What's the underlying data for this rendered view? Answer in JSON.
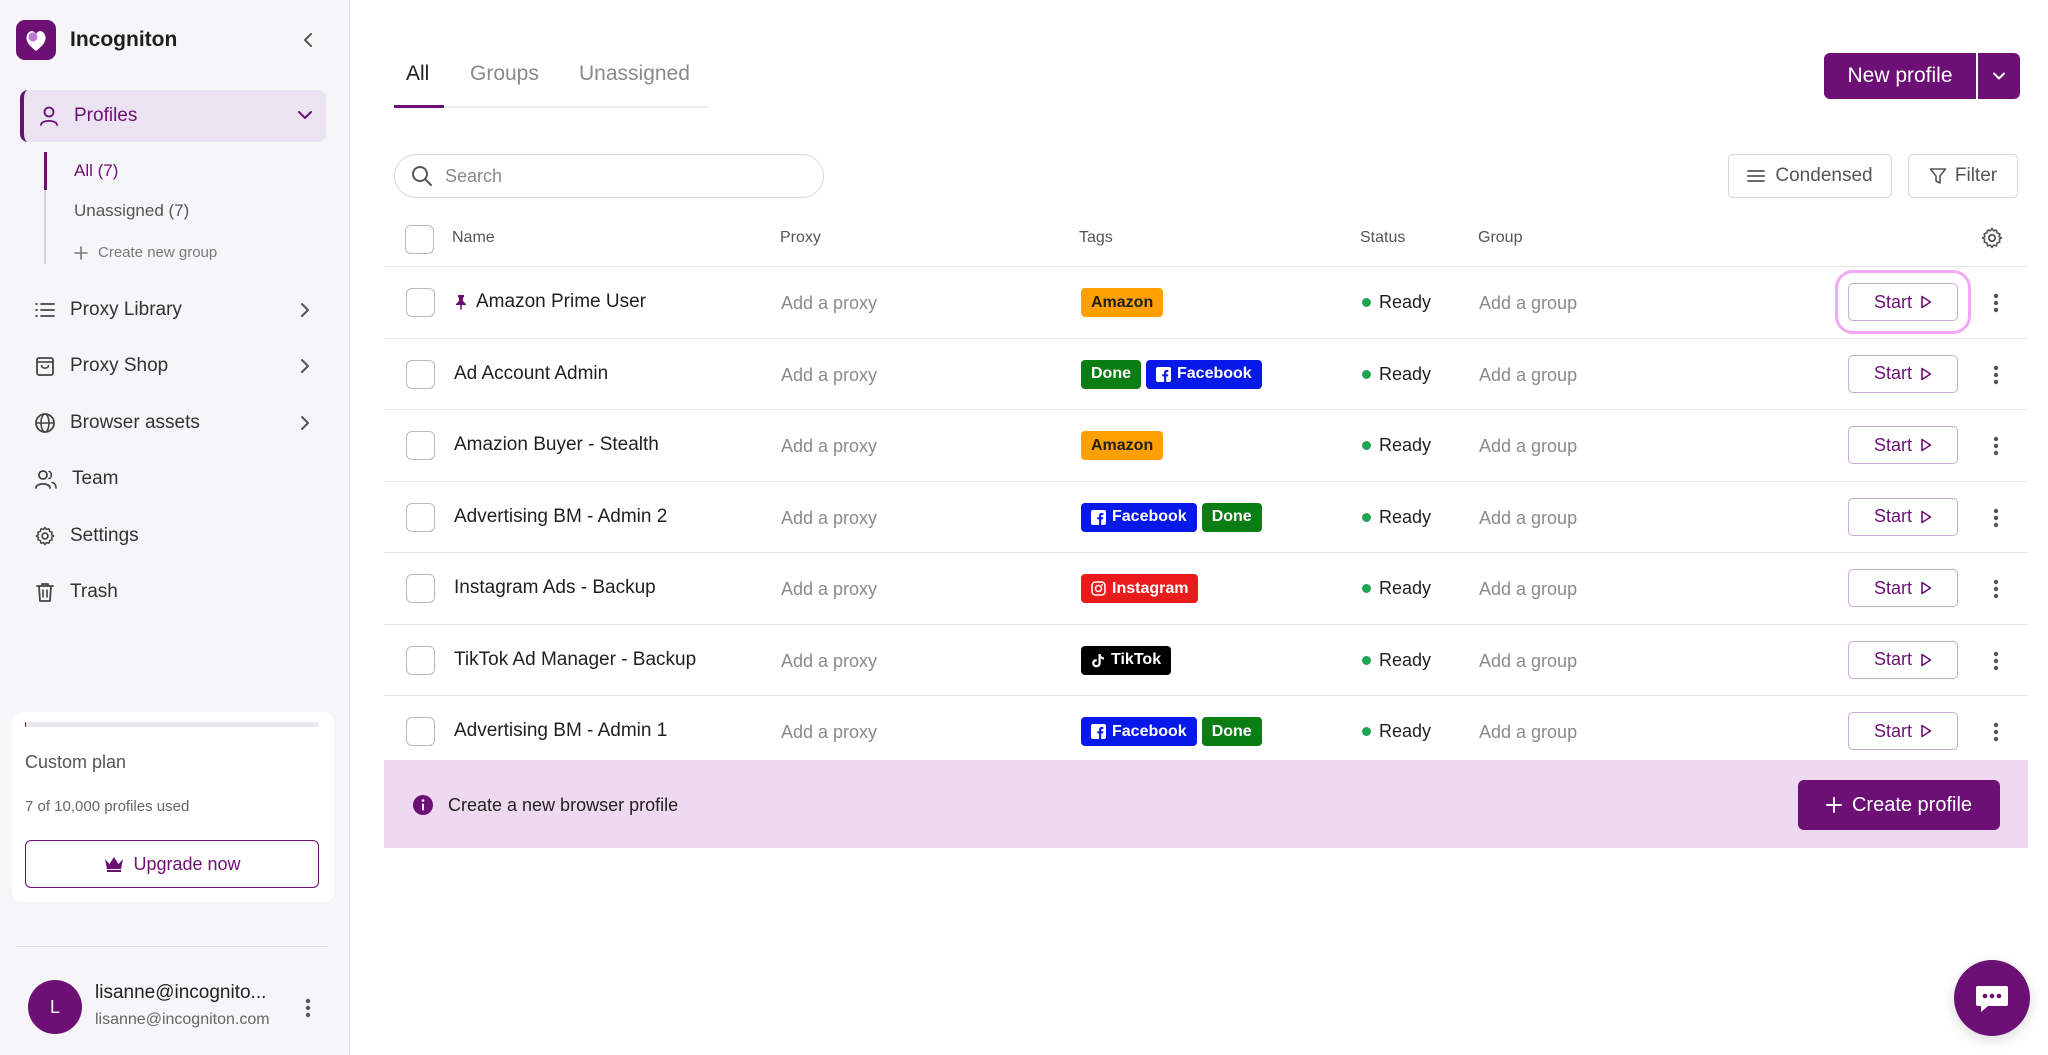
{
  "brand": {
    "name": "Incogniton"
  },
  "colors": {
    "accent": "#6d1075",
    "accent_light": "#efd9f1",
    "status_ready": "#23a455",
    "tag_amazon": "#ff9f00",
    "tag_done": "#0a7d14",
    "tag_facebook": "#0719e8",
    "tag_instagram": "#ea1b1b",
    "tag_tiktok": "#000000"
  },
  "sidebar": {
    "profiles_label": "Profiles",
    "subitems": [
      {
        "label": "All (7)"
      },
      {
        "label": "Unassigned (7)"
      }
    ],
    "create_group_label": "Create new group",
    "items": [
      {
        "label": "Proxy Library",
        "icon": "list-icon"
      },
      {
        "label": "Proxy Shop",
        "icon": "shopping-bag-icon"
      },
      {
        "label": "Browser assets",
        "icon": "globe-icon"
      },
      {
        "label": "Team",
        "icon": "team-icon"
      },
      {
        "label": "Settings",
        "icon": "gear-icon"
      },
      {
        "label": "Trash",
        "icon": "trash-icon"
      }
    ],
    "plan": {
      "name": "Custom plan",
      "usage": "7 of 10,000 profiles used",
      "used_fraction": 0.0007,
      "upgrade_label": "Upgrade now"
    },
    "user": {
      "initial": "L",
      "name": "lisanne@incognito...",
      "email": "lisanne@incogniton.com"
    }
  },
  "main": {
    "tabs": [
      {
        "label": "All"
      },
      {
        "label": "Groups"
      },
      {
        "label": "Unassigned"
      }
    ],
    "new_profile_label": "New profile",
    "search_placeholder": "Search",
    "condensed_label": "Condensed",
    "filter_label": "Filter",
    "columns": {
      "name": "Name",
      "proxy": "Proxy",
      "tags": "Tags",
      "status": "Status",
      "group": "Group"
    },
    "rows": [
      {
        "name": "Amazon Prime User",
        "pinned": true,
        "proxy": "Add a proxy",
        "tags": [
          {
            "label": "Amazon",
            "kind": "amazon"
          }
        ],
        "status": "Ready",
        "group": "Add a group",
        "start_label": "Start"
      },
      {
        "name": "Ad Account Admin",
        "pinned": false,
        "proxy": "Add a proxy",
        "tags": [
          {
            "label": "Done",
            "kind": "done"
          },
          {
            "label": "Facebook",
            "kind": "facebook"
          }
        ],
        "status": "Ready",
        "group": "Add a group",
        "start_label": "Start"
      },
      {
        "name": "Amazion Buyer - Stealth",
        "pinned": false,
        "proxy": "Add a proxy",
        "tags": [
          {
            "label": "Amazon",
            "kind": "amazon"
          }
        ],
        "status": "Ready",
        "group": "Add a group",
        "start_label": "Start"
      },
      {
        "name": "Advertising BM - Admin 2",
        "pinned": false,
        "proxy": "Add a proxy",
        "tags": [
          {
            "label": "Facebook",
            "kind": "facebook"
          },
          {
            "label": "Done",
            "kind": "done"
          }
        ],
        "status": "Ready",
        "group": "Add a group",
        "start_label": "Start"
      },
      {
        "name": "Instagram Ads - Backup",
        "pinned": false,
        "proxy": "Add a proxy",
        "tags": [
          {
            "label": "Instagram",
            "kind": "instagram"
          }
        ],
        "status": "Ready",
        "group": "Add a group",
        "start_label": "Start"
      },
      {
        "name": "TikTok Ad Manager - Backup",
        "pinned": false,
        "proxy": "Add a proxy",
        "tags": [
          {
            "label": "TikTok",
            "kind": "tiktok"
          }
        ],
        "status": "Ready",
        "group": "Add a group",
        "start_label": "Start"
      },
      {
        "name": "Advertising BM - Admin 1",
        "pinned": false,
        "proxy": "Add a proxy",
        "tags": [
          {
            "label": "Facebook",
            "kind": "facebook"
          },
          {
            "label": "Done",
            "kind": "done"
          }
        ],
        "status": "Ready",
        "group": "Add a group",
        "start_label": "Start"
      }
    ],
    "create_banner": {
      "text": "Create a new browser profile",
      "button_label": "Create profile"
    }
  }
}
